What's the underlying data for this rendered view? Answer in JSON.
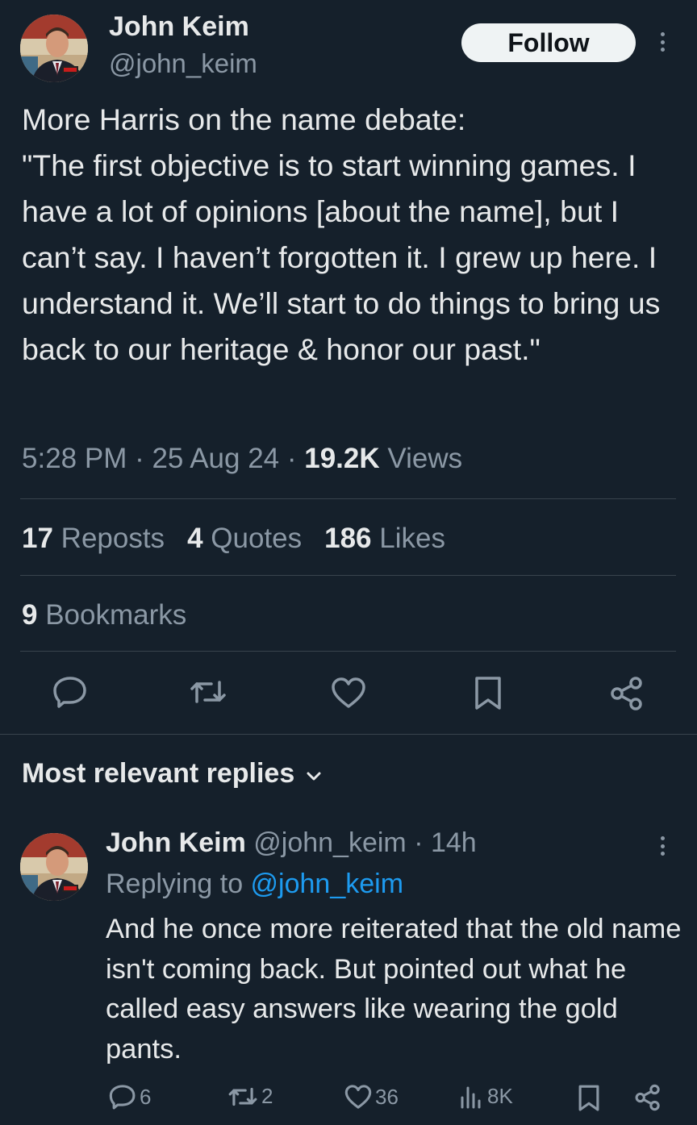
{
  "tweet": {
    "author_name": "John Keim",
    "author_handle": "@john_keim",
    "follow_label": "Follow",
    "body": "More Harris on the name debate:\n\"The first objective is to start winning games. I have a lot of opinions [about the name], but I can’t say. I haven’t forgotten it. I grew up here. I understand it. We’ll start to do things to bring us back to our heritage & honor our past.\"",
    "time": "5:28 PM",
    "sep1": " · ",
    "date": "25 Aug 24",
    "sep2": " · ",
    "views_count": "19.2K",
    "views_label": " Views",
    "reposts_count": "17",
    "reposts_label": " Reposts",
    "quotes_count": "4",
    "quotes_label": " Quotes",
    "likes_count": "186",
    "likes_label": " Likes",
    "bookmarks_count": "9",
    "bookmarks_label": " Bookmarks"
  },
  "replies_section": {
    "heading": "Most relevant replies"
  },
  "reply": {
    "author_name": "John Keim",
    "author_handle": " @john_keim",
    "time_sep": " · ",
    "time": "14h",
    "replying_prefix": "Replying to ",
    "replying_handle": "@john_keim",
    "body": "And he once more reiterated that the old name isn't coming back. But pointed out what he called easy answers like wearing the gold pants.",
    "reply_count": "6",
    "repost_count": "2",
    "like_count": "36",
    "views_count": "8K"
  },
  "icons": {
    "reply": "reply-icon",
    "repost": "repost-icon",
    "like": "heart-icon",
    "bookmark": "bookmark-icon",
    "share": "share-icon",
    "views": "views-icon",
    "more": "more-icon",
    "chevron": "chevron-down-icon"
  },
  "colors": {
    "background": "#15202b",
    "text": "#e7e9ea",
    "muted": "#8b98a5",
    "link": "#1d9bf0",
    "divider": "#38444d",
    "follow_bg": "#eff3f4"
  }
}
